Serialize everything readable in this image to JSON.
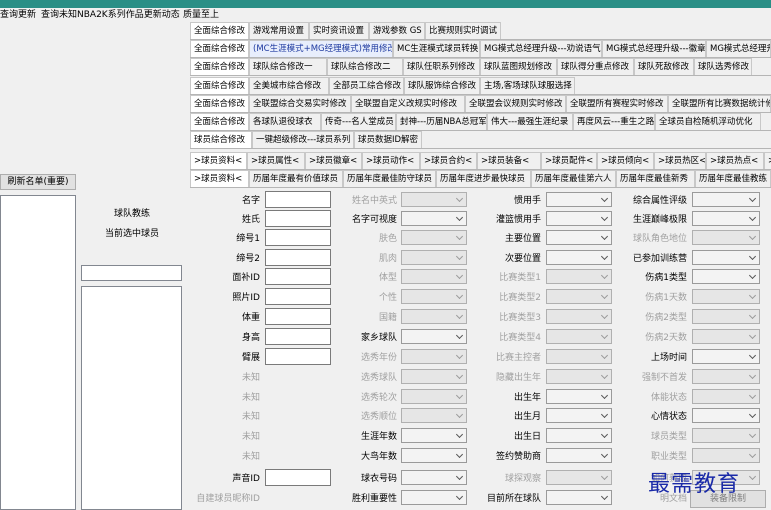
{
  "menu": [
    "查询更新",
    "查询未知NBA2K系列作品更新动态",
    "质量至上"
  ],
  "left": {
    "refresh_button": "刷新名单(重要)",
    "coach_label": "球队教练",
    "current_player_label": "当前选中球员"
  },
  "tab_rows": [
    [
      "全面综合修改",
      "游戏常用设置",
      "实时资讯设置",
      "游戏参数 GS",
      "比赛规则实时调试"
    ],
    [
      "全面综合修改",
      "(MC生涯模式+MG经理模式)常用修改",
      "MC生涯模式球员转换",
      "MG模式总经理升级---劝说语气",
      "MG模式总经理升级---徽章",
      "MG模式总经理升"
    ],
    [
      "全面综合修改",
      "球队综合修改一",
      "球队综合修改二",
      "球队任职系列修改",
      "球队蓝图规划修改",
      "球队得分重点修改",
      "球队死敌修改",
      "球队选秀修改"
    ],
    [
      "全面综合修改",
      "全美城市综合修改",
      "全部员工综合修改",
      "球队服饰综合修改",
      "主场,客场球队球服选择"
    ],
    [
      "全面综合修改",
      "全联盟综合交易实时修改",
      "全联盟自定义改规实时修改",
      "全联盟会议规则实时修改",
      "全联盟所有赛程实时修改",
      "全联盟所有比赛数据统计修改"
    ],
    [
      "全面综合修改",
      "各球队退役球衣",
      "传奇---名人堂成员",
      "封神---历届NBA总冠军",
      "伟大---最强生涯纪录",
      "再度风云---重生之路",
      "全球员自检随机浮动优化"
    ],
    [
      "球员综合修改",
      "一键超级修改---球员系列",
      "球员数据ID解密"
    ],
    [
      ">球员资料<",
      ">球员属性<",
      ">球员徽章<",
      ">球员动作<",
      ">球员合约<",
      ">球员装备<",
      ">球员配件<",
      ">球员倾向<",
      ">球员热区<",
      ">球员热点<",
      ">球员数据"
    ],
    [
      ">球员资料<",
      "历届年度最有价值球员",
      "历届年度最佳防守球员",
      "历届年度进步最快球员",
      "历届年度最佳第六人",
      "历届年度最佳新秀",
      "历届年度最佳教练"
    ]
  ],
  "col1": [
    "名字",
    "姓氏",
    "缔号1",
    "缔号2",
    "面补ID",
    "照片ID",
    "体重",
    "身高",
    "臂展",
    "未知",
    "未知",
    "未知",
    "未知",
    "未知",
    "声音ID",
    "自建球员昵称ID"
  ],
  "col2": [
    "姓名中英式",
    "名字可视度",
    "肤色",
    "肌肉",
    "体型",
    "个性",
    "国籍",
    "家乡球队",
    "选秀年份",
    "选秀球队",
    "选秀轮次",
    "选秀顺位",
    "生涯年数",
    "大鸟年数",
    "球衣号码",
    "胜利重要性"
  ],
  "col3": [
    "惯用手",
    "灌篮惯用手",
    "主要位置",
    "次要位置",
    "比赛类型1",
    "比赛类型2",
    "比赛类型3",
    "比赛类型4",
    "比赛主控者",
    "隐藏出生年",
    "出生年",
    "出生月",
    "出生日",
    "签约赞助商",
    "球探观察",
    "目前所在球队"
  ],
  "col4": [
    "综合属性评级",
    "生涯巅峰极限",
    "球队角色地位",
    "已参加训练营",
    "伤病1类型",
    "伤病1天数",
    "伤病2类型",
    "伤病2天数",
    "上场时间",
    "强制不首发",
    "体能状态",
    "心情状态",
    "球员类型",
    "职业类型",
    "如何获取",
    "明文档"
  ],
  "bottom_button": "装备限制",
  "watermark": "最需教育"
}
